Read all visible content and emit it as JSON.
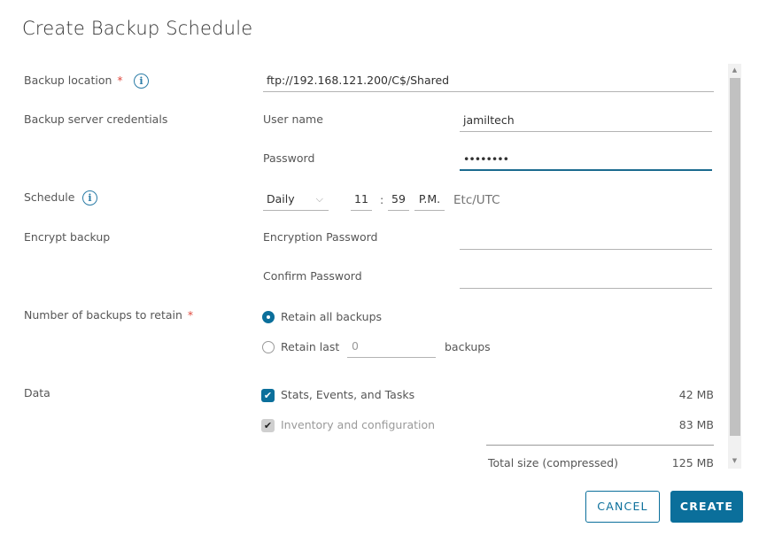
{
  "dialog": {
    "title": "Create Backup Schedule"
  },
  "backup_location": {
    "label": "Backup location",
    "required_mark": "*",
    "value": "ftp://192.168.121.200/C$/Shared"
  },
  "credentials": {
    "label": "Backup server credentials",
    "username_label": "User name",
    "username_value": "jamiltech",
    "password_label": "Password",
    "password_value": "••••••••"
  },
  "schedule": {
    "label": "Schedule",
    "frequency": "Daily",
    "hour": "11",
    "separator": ":",
    "minute": "59",
    "ampm": "P.M.",
    "timezone": "Etc/UTC"
  },
  "encrypt": {
    "label": "Encrypt backup",
    "encryption_password_label": "Encryption Password",
    "encryption_password_value": "",
    "confirm_password_label": "Confirm Password",
    "confirm_password_value": ""
  },
  "retain": {
    "label": "Number of backups to retain",
    "required_mark": "*",
    "option_all": "Retain all backups",
    "option_last": "Retain last",
    "last_count_placeholder": "0",
    "suffix": "backups",
    "selected": "all"
  },
  "data": {
    "label": "Data",
    "items": [
      {
        "label": "Stats, Events, and Tasks",
        "size": "42 MB",
        "checked": true,
        "disabled": false
      },
      {
        "label": "Inventory and configuration",
        "size": "83 MB",
        "checked": true,
        "disabled": true
      }
    ],
    "total_label": "Total size (compressed)",
    "total_size": "125 MB"
  },
  "footer": {
    "cancel_label": "CANCEL",
    "create_label": "CREATE"
  },
  "icons": {
    "info": "i",
    "chevron_down": "⌵",
    "check": "✔",
    "scroll_up": "▲",
    "scroll_down": "▼"
  },
  "colors": {
    "accent": "#0b6f9b",
    "required": "#e04a3f"
  }
}
